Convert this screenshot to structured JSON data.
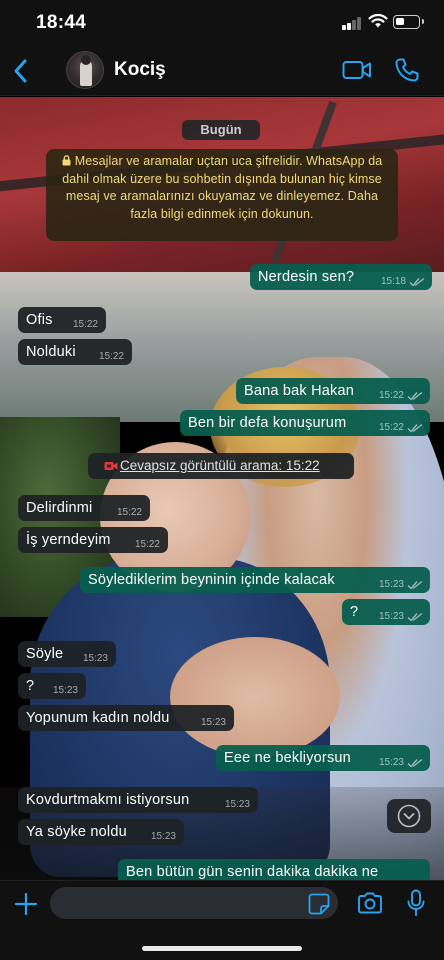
{
  "status_bar": {
    "time": "18:44"
  },
  "header": {
    "contact_name": "Kociş"
  },
  "chat": {
    "date_label": "Bugün",
    "encryption_notice": "Mesajlar ve aramalar uçtan uca şifrelidir. WhatsApp da dahil olmak üzere bu sohbetin dışında bulunan hiç kimse mesaj ve aramalarınızı okuyamaz ve dinleyemez. Daha fazla bilgi edinmek için dokunun.",
    "messages": [
      {
        "direction": "out",
        "text": "Nerdesin sen?",
        "time": "15:18"
      },
      {
        "direction": "in",
        "text": "Ofis",
        "time": "15:22"
      },
      {
        "direction": "in",
        "text": "Nolduki",
        "time": "15:22"
      },
      {
        "direction": "out",
        "text": "Bana bak Hakan",
        "time": "15:22"
      },
      {
        "direction": "out",
        "text": "Ben bir defa konuşurum",
        "time": "15:22"
      },
      {
        "direction": "in",
        "text": "Delirdinmi",
        "time": "15:22"
      },
      {
        "direction": "in",
        "text": "İş yerndeyim",
        "time": "15:22"
      },
      {
        "direction": "out",
        "text": "Söylediklerim beyninin içinde kalacak",
        "time": "15:23"
      },
      {
        "direction": "out",
        "text": "?",
        "time": "15:23"
      },
      {
        "direction": "in",
        "text": "Söyle",
        "time": "15:23"
      },
      {
        "direction": "in",
        "text": "?",
        "time": "15:23"
      },
      {
        "direction": "in",
        "text": "Yopunum kadın noldu",
        "time": "15:23"
      },
      {
        "direction": "out",
        "text": "Eee ne bekliyorsun",
        "time": "15:23"
      },
      {
        "direction": "in",
        "text": "Kovdurtmakmı istiyorsun",
        "time": "15:23"
      },
      {
        "direction": "in",
        "text": "Ya söyke noldu",
        "time": "15:23"
      },
      {
        "direction": "out",
        "text": "Ben bütün gün senin dakika dakika ne",
        "time": ""
      }
    ],
    "missed_call": "Cevapsız görüntülü arama: 15:22"
  },
  "input": {
    "placeholder": ""
  },
  "colors": {
    "outgoing_bubble": "#075e4e",
    "incoming_bubble": "#1e2225",
    "accent": "#2aa3ef",
    "encryption_text": "#f4d97a",
    "missed_call_icon": "#e5373d"
  },
  "icons": [
    "back-chevron",
    "video-camera",
    "phone",
    "lock",
    "double-check",
    "missed-video-call",
    "chevron-down",
    "plus",
    "sticker",
    "camera",
    "microphone"
  ]
}
